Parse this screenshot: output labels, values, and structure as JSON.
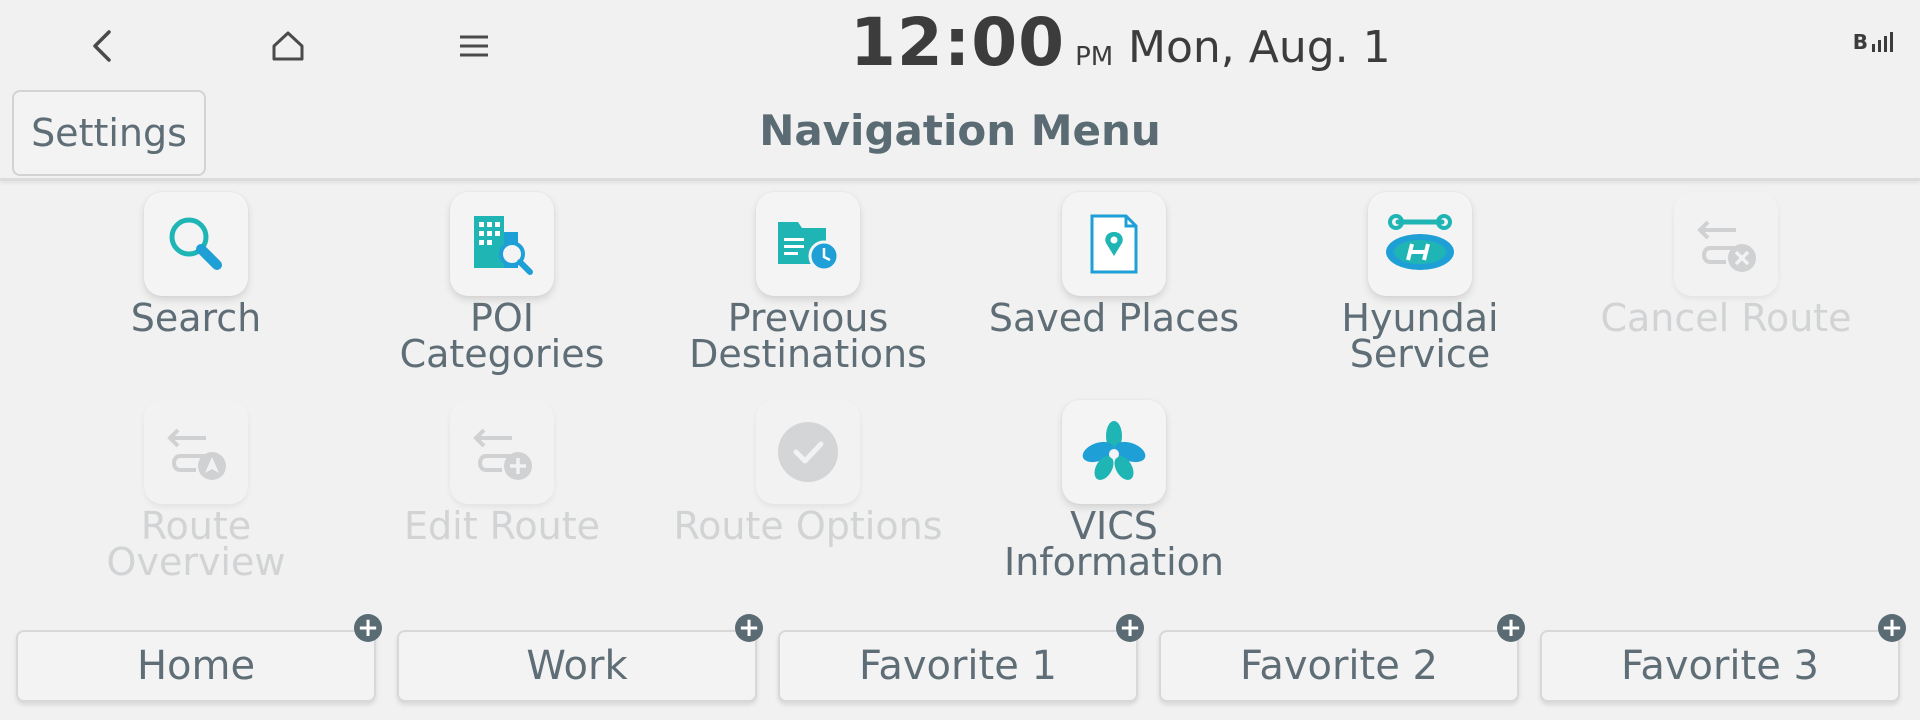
{
  "status_bar": {
    "time": "12:00",
    "ampm": "PM",
    "date": "Mon, Aug. 1",
    "signal_label": "B"
  },
  "header": {
    "settings_label": "Settings",
    "title": "Navigation Menu"
  },
  "menu": {
    "items": [
      {
        "label": "Search",
        "icon": "search-icon",
        "enabled": true
      },
      {
        "label": "POI\nCategories",
        "icon": "poi-categories-icon",
        "enabled": true
      },
      {
        "label": "Previous\nDestinations",
        "icon": "previous-destinations-icon",
        "enabled": true
      },
      {
        "label": "Saved Places",
        "icon": "saved-places-icon",
        "enabled": true
      },
      {
        "label": "Hyundai\nService",
        "icon": "hyundai-service-icon",
        "enabled": true
      },
      {
        "label": "Cancel Route",
        "icon": "cancel-route-icon",
        "enabled": false
      },
      {
        "label": "Route\nOverview",
        "icon": "route-overview-icon",
        "enabled": false
      },
      {
        "label": "Edit Route",
        "icon": "edit-route-icon",
        "enabled": false
      },
      {
        "label": "Route Options",
        "icon": "route-options-icon",
        "enabled": false
      },
      {
        "label": "VICS\nInformation",
        "icon": "vics-information-icon",
        "enabled": true
      }
    ]
  },
  "favorites": [
    {
      "label": "Home"
    },
    {
      "label": "Work"
    },
    {
      "label": "Favorite 1"
    },
    {
      "label": "Favorite 2"
    },
    {
      "label": "Favorite 3"
    }
  ],
  "colors": {
    "accent_teal": "#1fb5b5",
    "accent_blue": "#1e9fd6",
    "text": "#5f6e76",
    "disabled": "#d1d3d4"
  }
}
